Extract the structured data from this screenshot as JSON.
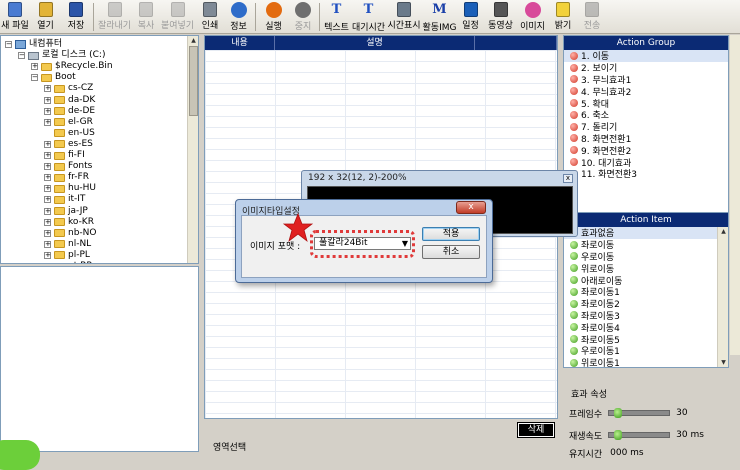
{
  "toolbar": [
    {
      "label": "새 파일",
      "icon": "new-file-icon",
      "disabled": false
    },
    {
      "label": "열기",
      "icon": "open-folder-icon",
      "disabled": false
    },
    {
      "label": "저장",
      "icon": "save-disk-icon",
      "disabled": false
    },
    {
      "label": "잘라내기",
      "icon": "scissors-icon",
      "disabled": true
    },
    {
      "label": "복사",
      "icon": "copy-icon",
      "disabled": true
    },
    {
      "label": "붙여넣기",
      "icon": "paste-icon",
      "disabled": true
    },
    {
      "label": "인쇄",
      "icon": "printer-icon",
      "disabled": false
    },
    {
      "label": "정보",
      "icon": "help-icon",
      "disabled": false
    },
    {
      "label": "실행",
      "icon": "play-icon",
      "disabled": false
    },
    {
      "label": "중지",
      "icon": "stop-icon",
      "disabled": true
    },
    {
      "label": "텍스트",
      "icon": "text-t-icon",
      "disabled": false
    },
    {
      "label": "대기시간",
      "icon": "wait-time-icon",
      "disabled": false
    },
    {
      "label": "시간표시",
      "icon": "clock-icon",
      "disabled": false
    },
    {
      "label": "활동IMG",
      "icon": "image-m-icon",
      "disabled": false
    },
    {
      "label": "일정",
      "icon": "schedule-icon",
      "disabled": false
    },
    {
      "label": "동영상",
      "icon": "film-icon",
      "disabled": false
    },
    {
      "label": "이미지",
      "icon": "image-icon",
      "disabled": false
    },
    {
      "label": "밝기",
      "icon": "lightbulb-icon",
      "disabled": false
    },
    {
      "label": "전송",
      "icon": "transfer-icon",
      "disabled": true
    }
  ],
  "tree": {
    "root": "내컴퓨터",
    "drive": "로컬 디스크 (C:)",
    "recycle": "$Recycle.Bin",
    "boot": "Boot",
    "boot_children": [
      "cs-CZ",
      "da-DK",
      "de-DE",
      "el-GR",
      "en-US",
      "es-ES",
      "fi-FI",
      "Fonts",
      "fr-FR",
      "hu-HU",
      "it-IT",
      "ja-JP",
      "ko-KR",
      "nb-NO",
      "nl-NL",
      "pl-PL",
      "pt-BR"
    ]
  },
  "grid": {
    "col1": "내용",
    "col2": "설명"
  },
  "delete_button": "삭제",
  "area_select_label": "영역선택",
  "action_group": {
    "title": "Action Group",
    "items": [
      "1. 이동",
      "2. 보이기",
      "3. 무늬효과1",
      "4. 무늬효과2",
      "5. 확대",
      "6. 축소",
      "7. 돌리기",
      "8. 화면전환1",
      "9. 화면전환2",
      "10. 대기효과",
      "11. 화면전환3"
    ]
  },
  "action_item": {
    "title": "Action Item",
    "items": [
      "효과없음",
      "좌로이동",
      "우로이동",
      "위로이동",
      "아래로이동",
      "좌로이동1",
      "좌로이동2",
      "좌로이동3",
      "좌로이동4",
      "좌로이동5",
      "우로이동1",
      "위로이동1"
    ]
  },
  "effect_props": {
    "title": "효과 속성",
    "frame_label": "프레임수",
    "frame_value": "30",
    "frame_level": 0.08,
    "speed_label": "재생속도",
    "speed_value": "30 ms",
    "speed_level": 0.08,
    "hold_label": "유지시간",
    "hold_value": "000 ms"
  },
  "preview": {
    "title": "192 x 32(12, 2)-200%",
    "close": "x"
  },
  "dialog": {
    "title": "이미지타입설정",
    "close": "x",
    "format_label": "이미지 포맷 :",
    "format_value": "풀칼라24Bit",
    "apply": "적용",
    "cancel": "취소"
  }
}
